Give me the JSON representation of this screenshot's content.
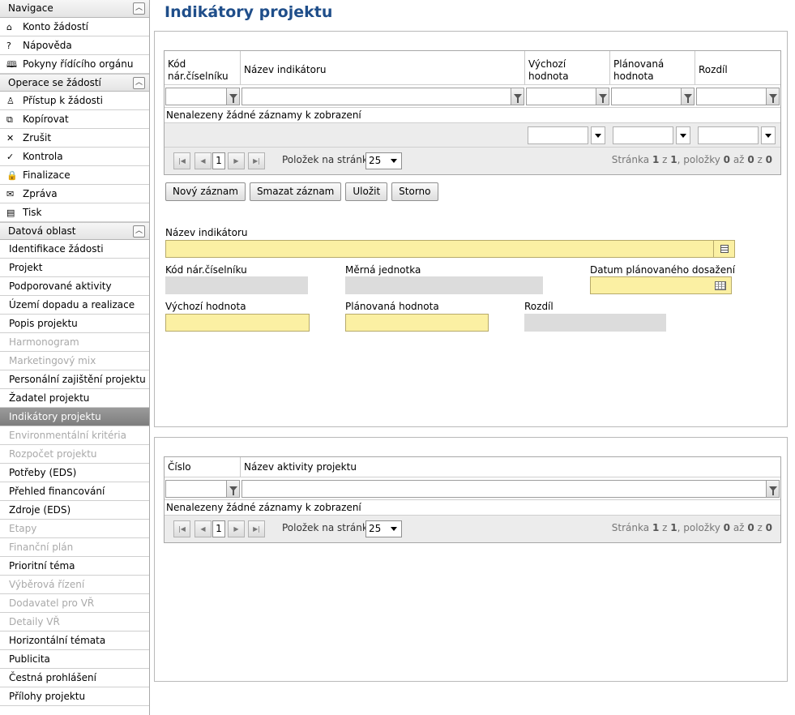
{
  "sidebar": {
    "sections": [
      {
        "title": "Navigace",
        "items": [
          {
            "label": "Konto žádostí",
            "icon": "home-icon",
            "glyph": "⌂",
            "state": "normal"
          },
          {
            "label": "Nápověda",
            "icon": "help-icon",
            "glyph": "?",
            "state": "normal"
          },
          {
            "label": "Pokyny řídícího orgánu",
            "icon": "book-icon",
            "glyph": "🕮",
            "state": "normal"
          }
        ]
      },
      {
        "title": "Operace se žádostí",
        "items": [
          {
            "label": "Přístup k žádosti",
            "icon": "user-icon",
            "glyph": "♙",
            "state": "normal"
          },
          {
            "label": "Kopírovat",
            "icon": "copy-icon",
            "glyph": "⧉",
            "state": "normal"
          },
          {
            "label": "Zrušit",
            "icon": "cross-icon",
            "glyph": "✕",
            "state": "normal"
          },
          {
            "label": "Kontrola",
            "icon": "check-icon",
            "glyph": "✓",
            "state": "normal"
          },
          {
            "label": "Finalizace",
            "icon": "lock-icon",
            "glyph": "🔒",
            "state": "normal"
          },
          {
            "label": "Zpráva",
            "icon": "envelope-icon",
            "glyph": "✉",
            "state": "normal"
          },
          {
            "label": "Tisk",
            "icon": "print-icon",
            "glyph": "▤",
            "state": "normal"
          }
        ]
      },
      {
        "title": "Datová oblast",
        "items": [
          {
            "label": "Identifikace žádosti",
            "state": "normal"
          },
          {
            "label": "Projekt",
            "state": "normal"
          },
          {
            "label": "Podporované aktivity",
            "state": "normal"
          },
          {
            "label": "Území dopadu a realizace",
            "state": "normal"
          },
          {
            "label": "Popis projektu",
            "state": "normal"
          },
          {
            "label": "Harmonogram",
            "state": "disabled"
          },
          {
            "label": "Marketingový mix",
            "state": "disabled"
          },
          {
            "label": "Personální zajištění projektu",
            "state": "normal"
          },
          {
            "label": "Žadatel projektu",
            "state": "normal"
          },
          {
            "label": "Indikátory projektu",
            "state": "active"
          },
          {
            "label": "Environmentální kritéria",
            "state": "disabled"
          },
          {
            "label": "Rozpočet projektu",
            "state": "disabled"
          },
          {
            "label": "Potřeby (EDS)",
            "state": "normal"
          },
          {
            "label": "Přehled financování",
            "state": "normal"
          },
          {
            "label": "Zdroje (EDS)",
            "state": "normal"
          },
          {
            "label": "Etapy",
            "state": "disabled"
          },
          {
            "label": "Finanční plán",
            "state": "disabled"
          },
          {
            "label": "Prioritní téma",
            "state": "normal"
          },
          {
            "label": "Výběrová řízení",
            "state": "disabled"
          },
          {
            "label": "Dodavatel pro VŘ",
            "state": "disabled"
          },
          {
            "label": "Detaily VŘ",
            "state": "disabled"
          },
          {
            "label": "Horizontální témata",
            "state": "normal"
          },
          {
            "label": "Publicita",
            "state": "normal"
          },
          {
            "label": "Čestná prohlášení",
            "state": "normal"
          },
          {
            "label": "Přílohy projektu",
            "state": "normal"
          }
        ]
      }
    ],
    "collapse_glyph": "︿"
  },
  "page": {
    "title": "Indikátory projektu"
  },
  "grid1": {
    "columns": [
      {
        "label": "Kód nár.číselníku"
      },
      {
        "label": "Název indikátoru"
      },
      {
        "label": "Výchozí hodnota"
      },
      {
        "label": "Plánovaná hodnota"
      },
      {
        "label": "Rozdíl"
      }
    ],
    "filter_values": [
      "",
      "",
      "",
      "",
      ""
    ],
    "empty_message": "Nenalezeny žádné záznamy k zobrazení",
    "pager": {
      "page_value": "1",
      "per_page_label": "Položek na stránku",
      "per_page_value": "25",
      "info_prefix": "Stránka",
      "page": "1",
      "of_label": "z",
      "pages": "1",
      "items_label": ", položky",
      "from": "0",
      "to_label": "až",
      "to": "0",
      "total_label": "z",
      "total": "0"
    }
  },
  "toolbar": {
    "new_label": "Nový záznam",
    "delete_label": "Smazat záznam",
    "save_label": "Uložit",
    "cancel_label": "Storno"
  },
  "form": {
    "indicator_name_label": "Název indikátoru",
    "indicator_name_value": "",
    "code_label": "Kód nár.číselníku",
    "unit_label": "Měrná jednotka",
    "date_label": "Datum plánovaného dosažení",
    "initial_label": "Výchozí hodnota",
    "planned_label": "Plánovaná hodnota",
    "diff_label": "Rozdíl"
  },
  "grid2": {
    "columns": [
      {
        "label": "Číslo"
      },
      {
        "label": "Název aktivity projektu"
      }
    ],
    "filter_values": [
      "",
      ""
    ],
    "empty_message": "Nenalezeny žádné záznamy k zobrazení",
    "pager": {
      "page_value": "1",
      "per_page_label": "Položek na stránku",
      "per_page_value": "25",
      "info_prefix": "Stránka",
      "page": "1",
      "of_label": "z",
      "pages": "1",
      "items_label": ", položky",
      "from": "0",
      "to_label": "až",
      "to": "0",
      "total_label": "z",
      "total": "0"
    }
  },
  "colors": {
    "title": "#1f4e8a",
    "required_field": "#fbf0a3",
    "readonly_field": "#dcdcdc",
    "active_nav": "#8a8a8a"
  }
}
